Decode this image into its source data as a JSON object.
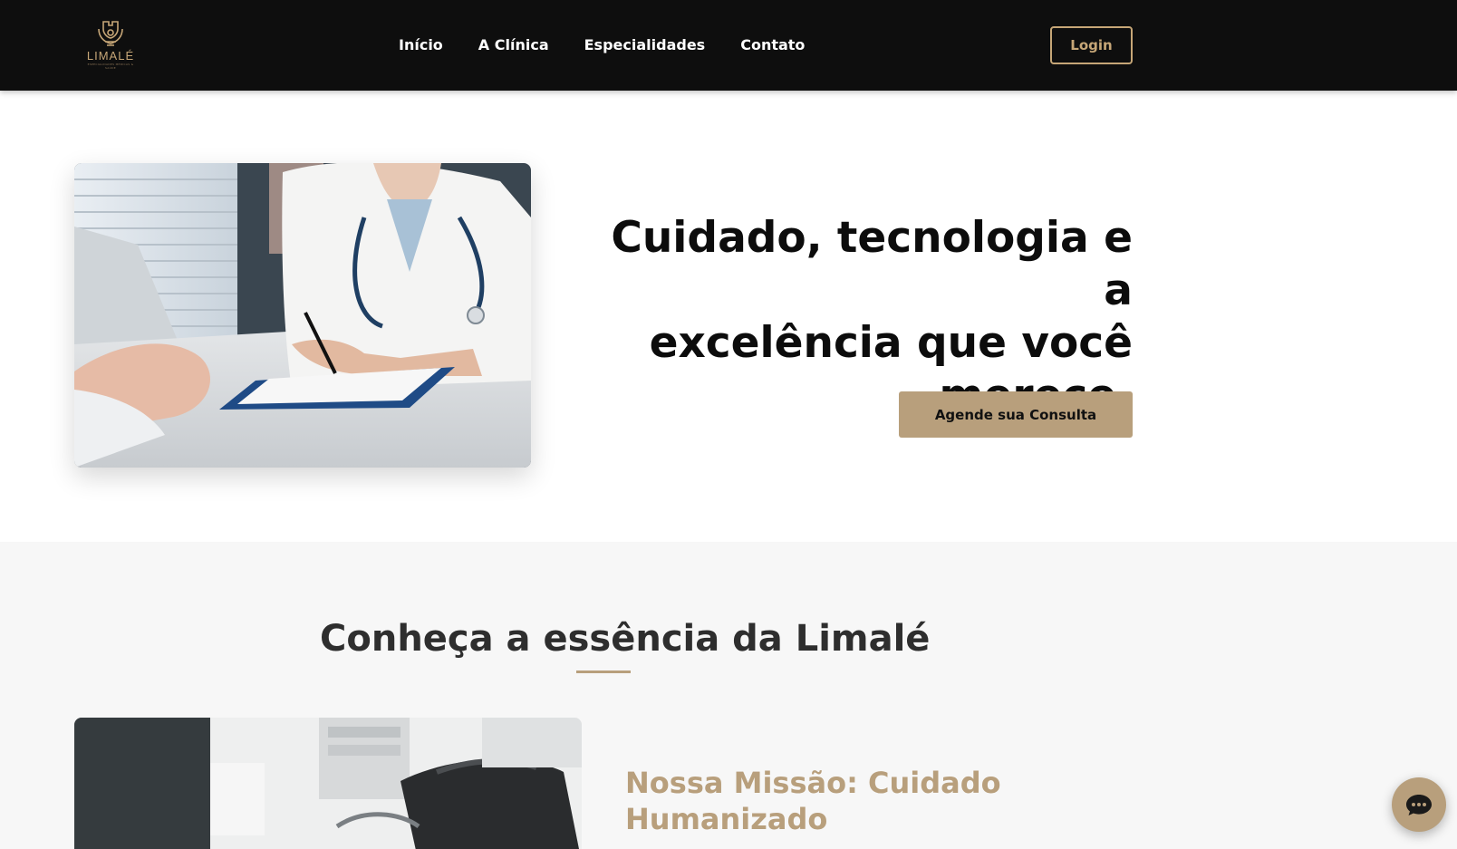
{
  "header": {
    "logo_text": "LIMALÉ",
    "logo_subtext": "ESPECIALIDADES MÉDICAS & SAÚDE",
    "nav": [
      "Início",
      "A Clínica",
      "Especialidades",
      "Contato"
    ],
    "login_label": "Login"
  },
  "hero": {
    "title_lines": [
      "Cuidado, tecnologia e a",
      "excelência que você",
      "merece."
    ],
    "cta_label": "Agende sua Consulta"
  },
  "about": {
    "title": "Conheça a essência da Limalé",
    "mission_title": "Nossa Missão: Cuidado Humanizado"
  },
  "chat": {
    "icon": "chat-icon"
  },
  "colors": {
    "header_bg": "#0e0e0e",
    "accent": "#b89f7c",
    "gold_text": "#c6a677",
    "section_bg": "#f7f7f7"
  }
}
